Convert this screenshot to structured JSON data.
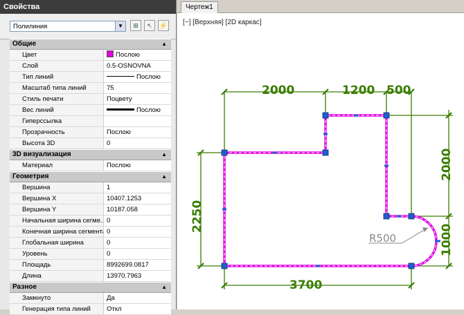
{
  "palette": {
    "title": "Свойства",
    "object_type": "Полилиния",
    "sections": {
      "general": {
        "title": "Общие",
        "rows": [
          {
            "key": "Цвет",
            "value": "Послою"
          },
          {
            "key": "Слой",
            "value": "0.5-OSNOVNA"
          },
          {
            "key": "Тип линий",
            "value": "Послою"
          },
          {
            "key": "Масштаб типа линий",
            "value": "75"
          },
          {
            "key": "Стиль печати",
            "value": "Поцвету"
          },
          {
            "key": "Вес линий",
            "value": "Послою"
          },
          {
            "key": "Гиперссылка",
            "value": ""
          },
          {
            "key": "Прозрачность",
            "value": "Послою"
          },
          {
            "key": "Высота 3D",
            "value": "0"
          }
        ]
      },
      "viz3d": {
        "title": "3D визуализация",
        "rows": [
          {
            "key": "Материал",
            "value": "Послою"
          }
        ]
      },
      "geometry": {
        "title": "Геометрия",
        "rows": [
          {
            "key": "Вершина",
            "value": "1"
          },
          {
            "key": "Вершина X",
            "value": "10407.1253"
          },
          {
            "key": "Вершина Y",
            "value": "10187.058"
          },
          {
            "key": "Начальная ширина сегме...",
            "value": "0"
          },
          {
            "key": "Конечная ширина сегмента",
            "value": "0"
          },
          {
            "key": "Глобальная ширина",
            "value": "0"
          },
          {
            "key": "Уровень",
            "value": "0"
          },
          {
            "key": "Площадь",
            "value": "8992699.0817"
          },
          {
            "key": "Длина",
            "value": "13970.7963"
          }
        ]
      },
      "misc": {
        "title": "Разное",
        "rows": [
          {
            "key": "Замкнуто",
            "value": "Да"
          },
          {
            "key": "Генерация типа линий",
            "value": "Откл"
          }
        ]
      }
    }
  },
  "drawing": {
    "tab_label": "Чертеж1",
    "viewport_label": "[−] [Верхняя] [2D каркас]",
    "dims": {
      "top_left": "2000",
      "top_mid": "1200",
      "top_right": "500",
      "right_upper": "2000",
      "right_lower": "1000",
      "left": "2250",
      "bottom": "3700",
      "radius": "R500"
    },
    "colors": {
      "polyline": "#e000e0",
      "dimension": "#3a7d00",
      "grip": "#1f5fd0",
      "leader": "#8a8a8a"
    }
  }
}
